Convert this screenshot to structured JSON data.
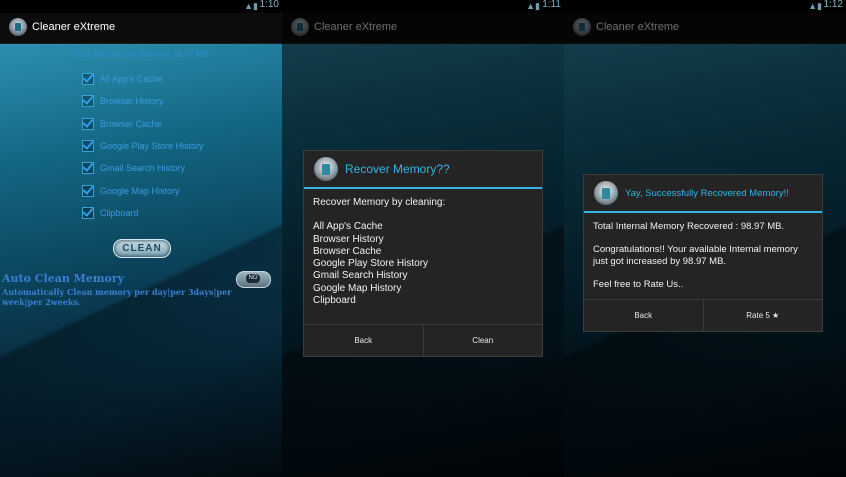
{
  "statusbar": {
    "screen1_time": "1:10",
    "screen2_time": "1:11",
    "screen3_time": "1:12",
    "icons": "wifi-icon signal-icon battery-icon"
  },
  "app": {
    "title": "Cleaner eXtreme"
  },
  "main": {
    "total_label": "Total Recoverable Memory: 98.97 MB",
    "checklist": [
      "All App's Cache",
      "Browser History",
      "Browser Cache",
      "Google Play Store History",
      "Gmail Search History",
      "Google Map History",
      "Clipboard"
    ],
    "clean_button": "CLEAN",
    "auto_clean_title": "Auto Clean Memory",
    "auto_clean_desc": "Automatically Clean memory per day|per 3days|per week|per 2weeks.",
    "toggle_label": "NO"
  },
  "dialog_recover": {
    "title": "Recover Memory??",
    "intro": "Recover Memory by cleaning:",
    "items": [
      "All App's Cache",
      "Browser History",
      "Browser Cache",
      "Google Play Store History",
      "Gmail Search History",
      "Google Map History",
      "Clipboard"
    ],
    "back_button": "Back",
    "clean_button": "Clean"
  },
  "dialog_success": {
    "title": "Yay, Successfully Recovered Memory!!",
    "total_line": "Total Internal Memory Recovered : 98.97 MB.",
    "congrats": "Congratulations!! Your available Internal memory just got increased by 98.97 MB.",
    "rate_line": "Feel free to Rate Us..",
    "back_button": "Back",
    "rate_button": "Rate 5 ★"
  },
  "colors": {
    "accent": "#33b5e5",
    "checklist_text": "#3a9be0",
    "dialog_bg": "#242424"
  }
}
